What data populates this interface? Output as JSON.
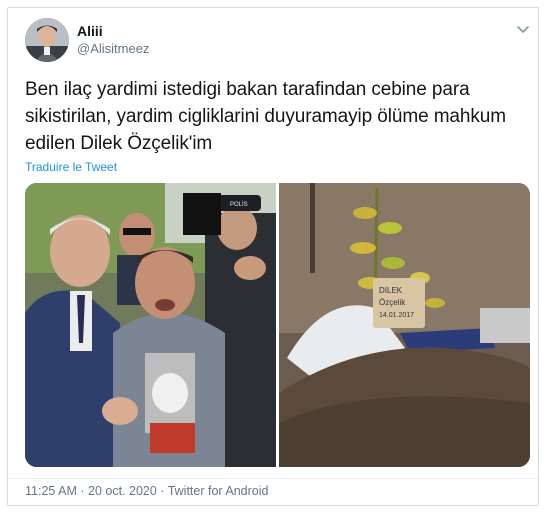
{
  "user": {
    "display_name": "Aliii",
    "handle": "@Alisitmeez",
    "avatar_icon": "avatar-photo"
  },
  "tweet": {
    "text": "Ben ilaç yardimi istedigi bakan tarafindan cebine para sikistirilan, yardim cigliklarini duyuramayip ölüme mahkum edilen Dilek Özçelik'im",
    "translate_label": "Traduire le Tweet"
  },
  "media": {
    "left_photo": {
      "description_icon": "protest-photo",
      "cap_text": "POLİS"
    },
    "right_photo": {
      "description_icon": "grave-photo",
      "marker_text_line1": "DILEK",
      "marker_text_line2": "Özçelik",
      "marker_text_line3": "14.01.2017"
    }
  },
  "meta": {
    "time": "11:25 AM",
    "separator1": " · ",
    "date": "20 oct. 2020",
    "separator2": " · ",
    "source": "Twitter for Android"
  },
  "colors": {
    "link": "#1b95e0",
    "secondary_text": "#657786",
    "primary_text": "#14171a"
  }
}
